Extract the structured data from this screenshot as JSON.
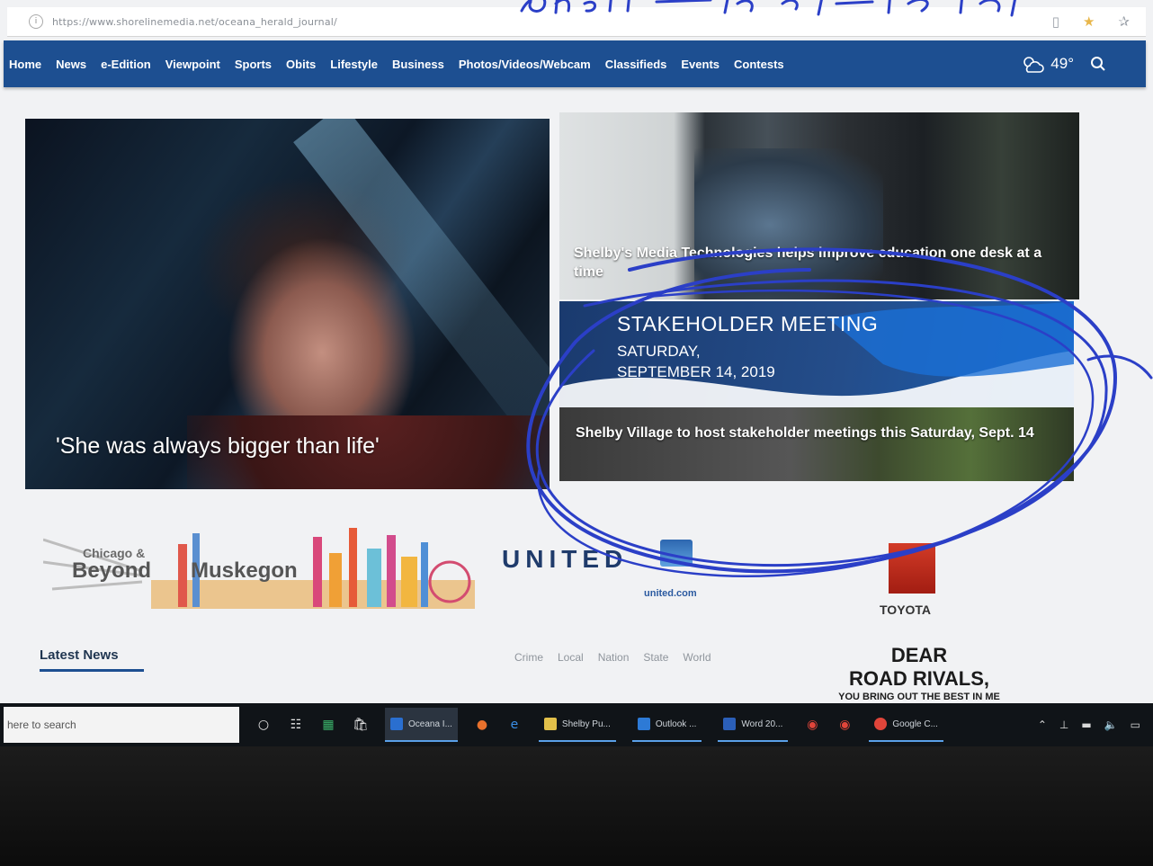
{
  "address_bar": {
    "url": "https://www.shorelinemedia.net/oceana_herald_journal/"
  },
  "nav": {
    "items": [
      "Home",
      "News",
      "e-Edition",
      "Viewpoint",
      "Sports",
      "Obits",
      "Lifestyle",
      "Business",
      "Photos/Videos/Webcam",
      "Classifieds",
      "Events",
      "Contests"
    ],
    "weather": "49°"
  },
  "hero": {
    "main_caption": "'She was always bigger than life'",
    "top_caption": "Shelby's Media Technologies helps improve education one desk at a time",
    "promo_headline": "STAKEHOLDER MEETING",
    "promo_day": "SATURDAY,",
    "promo_date": "SEPTEMBER 14, 2019",
    "bottom_caption": "Shelby Village to host stakeholder meetings this Saturday, Sept. 14"
  },
  "ads": {
    "chicago_line1": "Chicago &",
    "chicago_line2": "Beyond",
    "chicago_line3": "Muskegon",
    "united_brand": "UNITED",
    "united_site": "united.com",
    "toyota_label": "TOYOTA"
  },
  "lower": {
    "latest_news": "Latest News",
    "filters": [
      "Crime",
      "Local",
      "Nation",
      "State",
      "World"
    ],
    "dear_line1": "DEAR",
    "dear_line2": "ROAD RIVALS,",
    "dear_line3": "YOU BRING OUT THE BEST IN ME"
  },
  "taskbar": {
    "search_placeholder": "here to search",
    "apps": [
      "Oceana I...",
      "Shelby Pu...",
      "Outlook ...",
      "Word 20...",
      "Google C..."
    ]
  },
  "annotation": {
    "color": "#2b3fc7"
  }
}
